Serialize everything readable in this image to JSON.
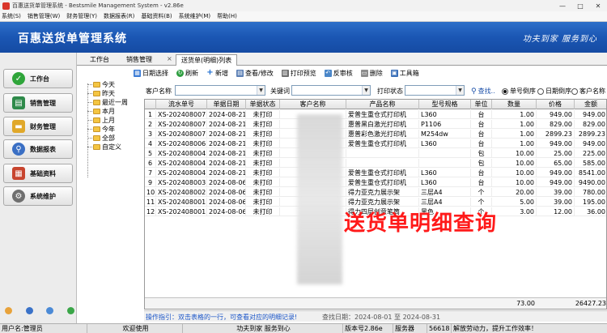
{
  "window": {
    "title": "百惠送货单管理系统 - Bestsmile Management System - v2.86e",
    "minimize": "—",
    "maximize": "□",
    "close": "✕"
  },
  "menu": [
    "系统(S)",
    "销售管理(W)",
    "财务管理(Y)",
    "数据报表(R)",
    "基础资料(B)",
    "系统维护(M)",
    "帮助(H)"
  ],
  "banner": {
    "title": "百惠送货单管理系统",
    "slogan": "功夫到家  服务到心"
  },
  "nav": [
    {
      "label": "工作台",
      "icon": "check-icon",
      "color": "#2fa53a"
    },
    {
      "label": "销售管理",
      "icon": "ledger-icon",
      "color": "#2e8a4a"
    },
    {
      "label": "财务管理",
      "icon": "folder-icon",
      "color": "#e0a82a"
    },
    {
      "label": "数据报表",
      "icon": "magnifier-icon",
      "color": "#3a6fc4"
    },
    {
      "label": "基础资料",
      "icon": "building-blocks-icon",
      "color": "#c8452f"
    },
    {
      "label": "系统维护",
      "icon": "gear-icon",
      "color": "#6f6f6f"
    }
  ],
  "tabs": {
    "t1": "工作台",
    "t2": "销售管理",
    "t3": "送货单(明细)列表",
    "close": "×"
  },
  "toolbar": [
    "日期选择",
    "刷新",
    "新增",
    "查看/修改",
    "打印预览",
    "反审核",
    "删除",
    "工具箱"
  ],
  "tree": [
    "今天",
    "昨天",
    "最近一周",
    "本月",
    "上月",
    "今年",
    "全部",
    "自定义"
  ],
  "filters": {
    "customer_label": "客户名称",
    "keyword_label": "关键词",
    "print_status_label": "打印状态",
    "search": "查找..",
    "sort_options": [
      "单号倒序",
      "日期倒序",
      "客户名称"
    ],
    "sort_selected": 0
  },
  "table": {
    "columns": [
      "",
      "流水单号",
      "单据日期",
      "单据状态",
      "客户名称",
      "产品名称",
      "型号规格",
      "单位",
      "数量",
      "价格",
      "金额"
    ],
    "rows": [
      [
        "1",
        "XS-202408007",
        "2024-08-21",
        "未打印",
        "",
        "爱普生重仓式打印机",
        "L360",
        "台",
        "1.00",
        "949.00",
        "949.00"
      ],
      [
        "2",
        "XS-202408007",
        "2024-08-21",
        "未打印",
        "",
        "惠普黑白激光打印机",
        "P1106",
        "台",
        "1.00",
        "829.00",
        "829.00"
      ],
      [
        "3",
        "XS-202408007",
        "2024-08-21",
        "未打印",
        "",
        "惠普彩色激光打印机",
        "M254dw",
        "台",
        "1.00",
        "2899.23",
        "2899.23"
      ],
      [
        "4",
        "XS-202408006",
        "2024-08-21",
        "未打印",
        "",
        "爱普生重仓式打印机",
        "L360",
        "台",
        "1.00",
        "949.00",
        "949.00"
      ],
      [
        "5",
        "XS-202408004",
        "2024-08-21",
        "未打印",
        "",
        "",
        "",
        "包",
        "10.00",
        "25.00",
        "225.00"
      ],
      [
        "6",
        "XS-202408004",
        "2024-08-21",
        "未打印",
        "",
        "",
        "",
        "包",
        "10.00",
        "65.00",
        "585.00"
      ],
      [
        "7",
        "XS-202408004",
        "2024-08-21",
        "未打印",
        "",
        "爱普生重仓式打印机",
        "L360",
        "台",
        "10.00",
        "949.00",
        "8541.00"
      ],
      [
        "9",
        "XS-202408003",
        "2024-08-06",
        "未打印",
        "",
        "爱普生重仓式打印机",
        "L360",
        "台",
        "10.00",
        "949.00",
        "9490.00"
      ],
      [
        "10",
        "XS-202408002",
        "2024-08-06",
        "未打印",
        "",
        "得力亚克力展示架",
        "三层A4",
        "个",
        "20.00",
        "39.00",
        "780.00"
      ],
      [
        "11",
        "XS-202408001",
        "2024-08-06",
        "未打印",
        "",
        "得力亚克力展示架",
        "三层A4",
        "个",
        "5.00",
        "39.00",
        "195.00"
      ],
      [
        "12",
        "XS-202408001",
        "2024-08-06",
        "未打印",
        "",
        "得力四层创意笔筒",
        "黑色",
        "个",
        "3.00",
        "12.00",
        "36.00"
      ]
    ],
    "total_qty": "73.00",
    "total_amount": "26427.23"
  },
  "watermark": "送货单明细查询",
  "hint": {
    "tip": "操作指引：双击表格的一行，可查看对应的明细记录!",
    "range": "查找日期：2024-08-01 至 2024-08-31"
  },
  "status": {
    "user": "用户名:管理员",
    "welcome": "欢迎使用",
    "motto": "功夫到家 服务到心",
    "version": "版本号2.86e",
    "service_label": "服务器",
    "service_value": "56618",
    "tagline": "解放劳动力，提升工作效率！"
  }
}
